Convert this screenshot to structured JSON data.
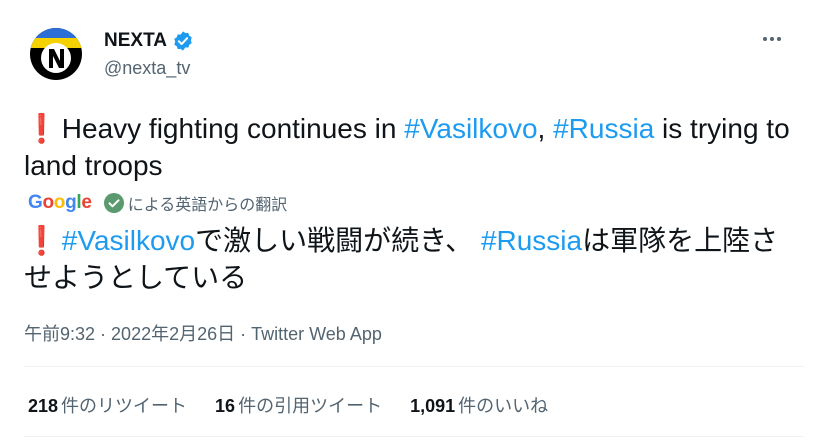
{
  "author": {
    "display_name": "NEXTA",
    "handle": "@nexta_tv",
    "avatar_icon": "nexta-logo-icon",
    "verified_icon": "verified-badge-icon"
  },
  "more_icon": "more-options-icon",
  "tweet": {
    "original": {
      "prefix_icon": "❗",
      "t1": " Heavy fighting continues in ",
      "h1": "#Vasilkovo",
      "t2": ", ",
      "h2": "#Russia",
      "t3": " is trying to land troops"
    },
    "translated_by": {
      "google": [
        "G",
        "o",
        "o",
        "g",
        "l",
        "e"
      ],
      "label": "による英語からの翻訳"
    },
    "translation": {
      "prefix_icon": "❗",
      "t1": " ",
      "h1": "#Vasilkovo",
      "t2": "で激しい戦闘が続き、 ",
      "h2": "#Russia",
      "t3": "は軍隊を上陸させようとしている"
    }
  },
  "meta": {
    "time": "午前9:32",
    "sep1": " · ",
    "date": "2022年2月26日",
    "sep2": " · ",
    "app": "Twitter Web App"
  },
  "stats": [
    {
      "num": "218",
      "label": "件のリツイート"
    },
    {
      "num": "16",
      "label": "件の引用ツイート"
    },
    {
      "num": "1,091",
      "label": "件のいいね"
    }
  ],
  "colors": {
    "hashtag": "#1d9bf0",
    "secondary_text": "#536471",
    "verified": "#1d9bf0",
    "exclamation": "#d0021b"
  }
}
